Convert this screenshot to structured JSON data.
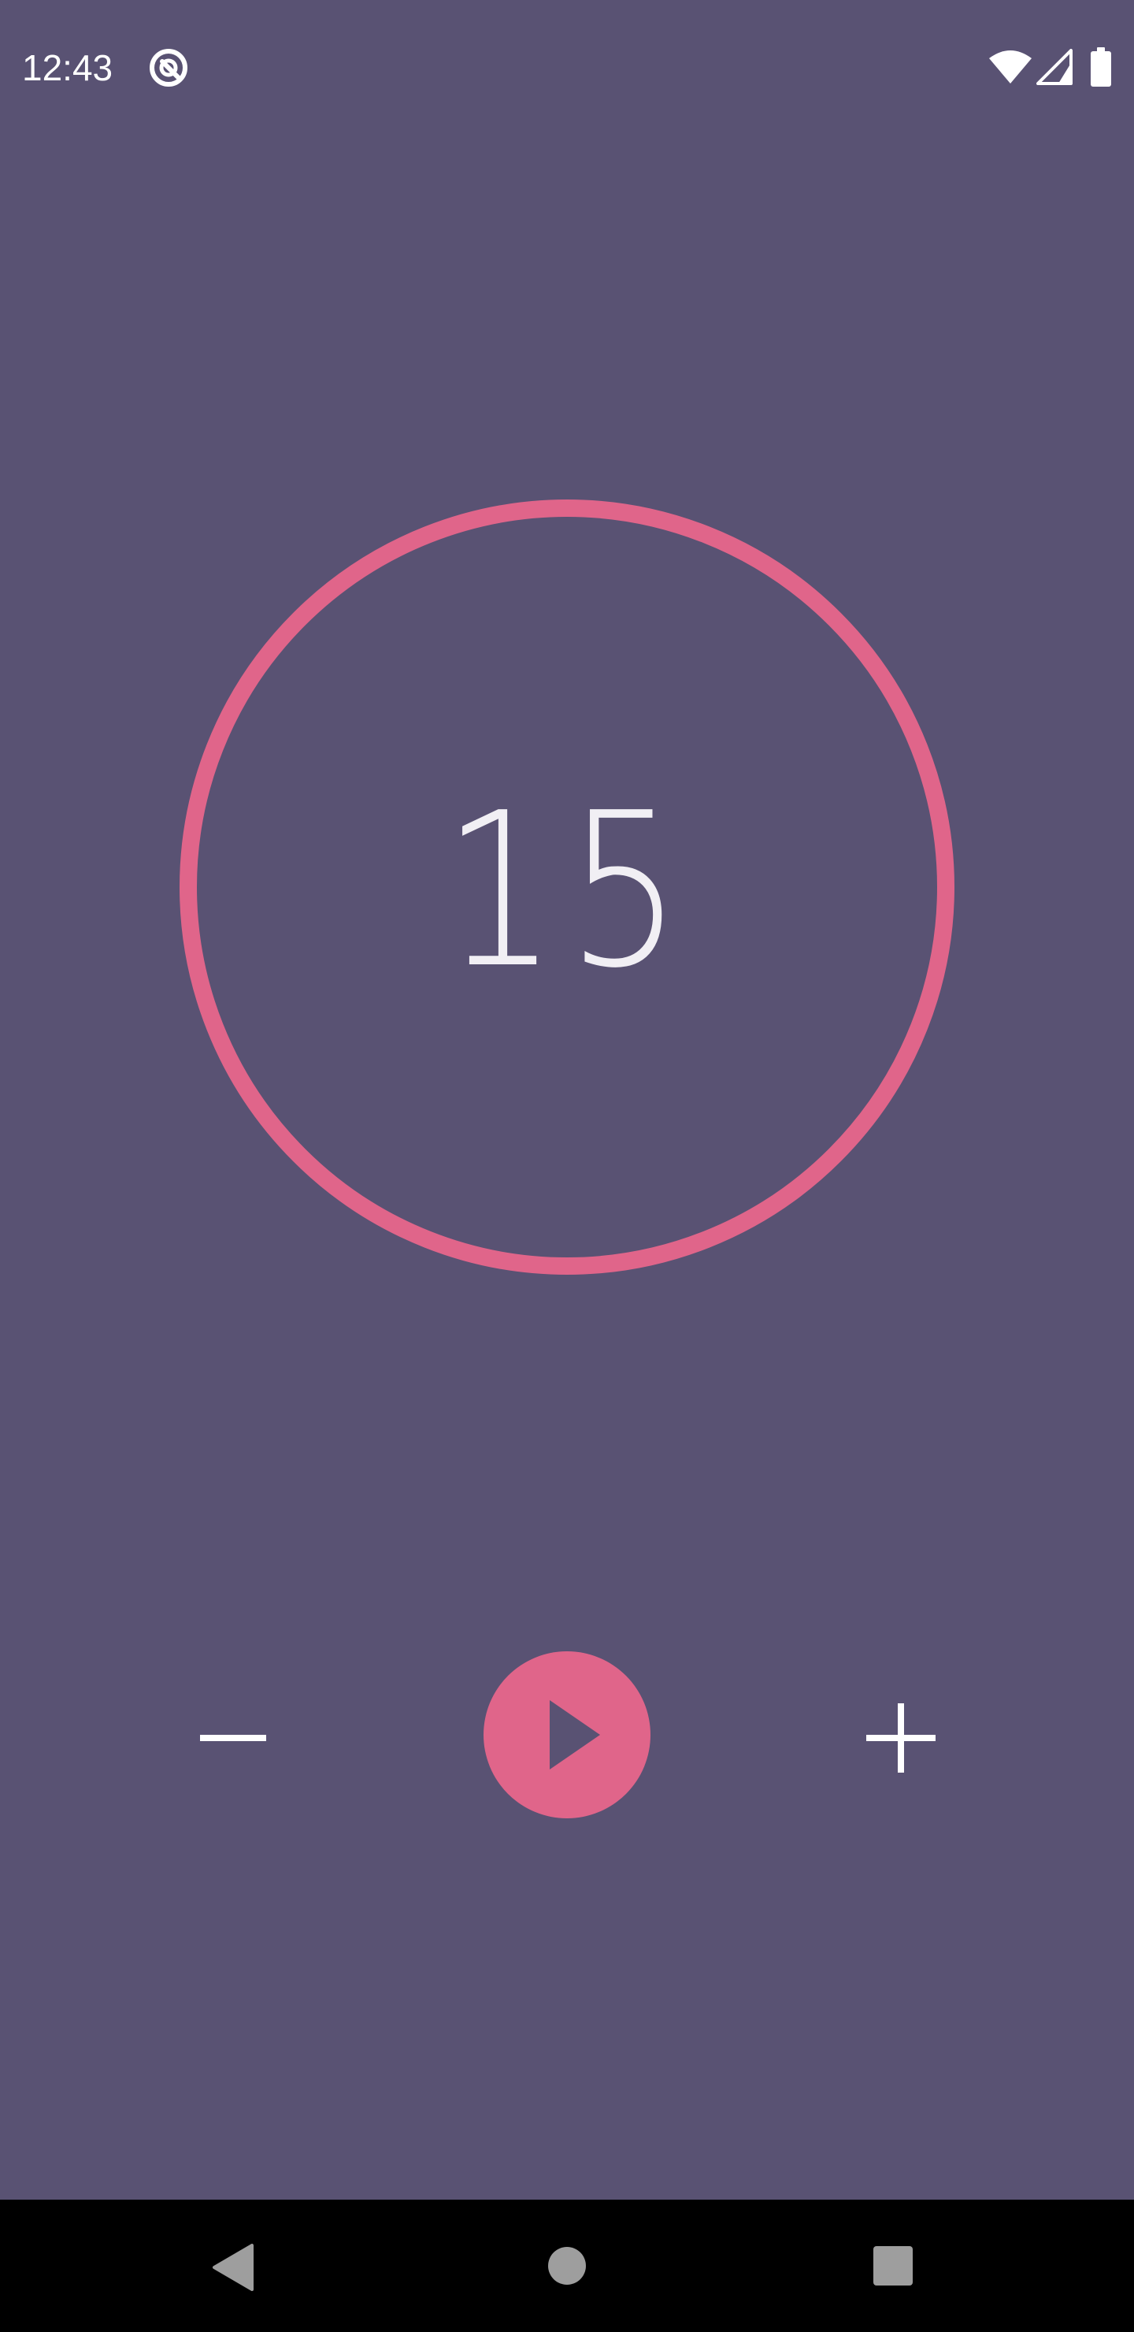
{
  "status_bar": {
    "time": "12:43",
    "icons": [
      "app-notification-icon",
      "wifi-icon",
      "signal-icon",
      "battery-icon"
    ]
  },
  "timer": {
    "value": "15"
  },
  "controls": {
    "decrement_icon": "minus-icon",
    "play_icon": "play-icon",
    "increment_icon": "plus-icon"
  },
  "navigation": {
    "icons": [
      "back-icon",
      "home-icon",
      "recents-icon"
    ]
  },
  "colors": {
    "background": "#595273",
    "accent": "#e0658a",
    "text": "#f1eff4",
    "nav_bar": "#000000",
    "nav_icon": "#9e9e9e"
  }
}
